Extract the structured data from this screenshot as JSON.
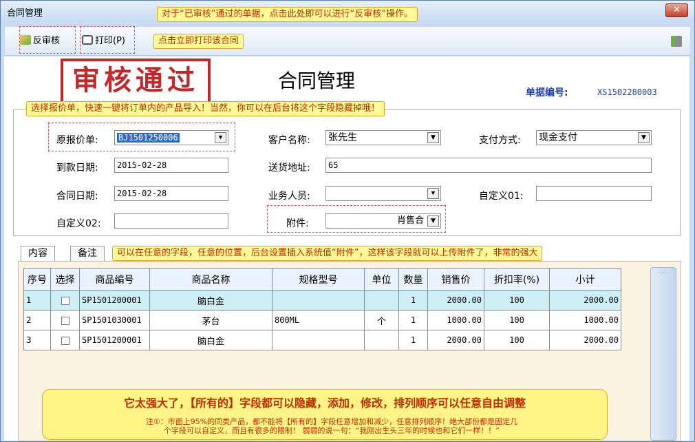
{
  "window": {
    "title": "合同管理",
    "close_glyph": "✕"
  },
  "toolbar": {
    "unreview_label": "反审核",
    "print_label": "打印(P)",
    "exit_icon": "exit-icon"
  },
  "callouts": {
    "unreview": "对于“已审核”通过的单据，点击此处即可以进行“反审核”操作。",
    "print": "点击立即打印该合同",
    "quote": "选择报价单，快速一键将订单内的产品导入！当然，你可以在后台将这个字段隐藏掉哦！",
    "attachment": "可以在任意的字段，任意的位置，后台设置插入系统值“附件”，这样该字段就可以上传附件了，非常的强大"
  },
  "header": {
    "stamp_text": "审核通过",
    "title": "合同管理",
    "doc_no_label": "单据编号:",
    "doc_no_value": "XS1502280003"
  },
  "form": {
    "quote_label": "原报价单:",
    "quote_value": "BJ1501250006",
    "customer_label": "客户名称:",
    "customer_value": "张先生",
    "payment_label": "支付方式:",
    "payment_value": "现金支付",
    "due_date_label": "到款日期:",
    "due_date_value": "2015-02-28",
    "address_label": "送货地址:",
    "address_value": "65",
    "contract_date_label": "合同日期:",
    "contract_date_value": "2015-02-28",
    "salesperson_label": "业务人员:",
    "salesperson_value": "",
    "custom01_label": "自定义01:",
    "custom01_value": "",
    "custom02_label": "自定义02:",
    "custom02_value": "",
    "attachment_label": "附件:",
    "attachment_value": "肖售合"
  },
  "tabs": [
    {
      "label": "内容"
    },
    {
      "label": "备注"
    }
  ],
  "grid": {
    "headers": [
      "序号",
      "选择",
      "商品编号",
      "商品名称",
      "规格型号",
      "单位",
      "数量",
      "销售价",
      "折扣率(%)",
      "小计"
    ],
    "rows": [
      {
        "no": "1",
        "code": "SP1501200001",
        "name": "脑白金",
        "spec": "",
        "unit": "",
        "qty": "1",
        "price": "2000.00",
        "discount": "100",
        "subtotal": "2000.00"
      },
      {
        "no": "2",
        "code": "SP1501030001",
        "name": "茅台",
        "spec": "800ML",
        "unit": "个",
        "qty": "1",
        "price": "1000.00",
        "discount": "100",
        "subtotal": "1000.00"
      },
      {
        "no": "3",
        "code": "SP1501200001",
        "name": "脑白金",
        "spec": "",
        "unit": "",
        "qty": "1",
        "price": "2000.00",
        "discount": "100",
        "subtotal": "2000.00"
      }
    ]
  },
  "note": {
    "main": "它太强大了，【所有的】字段都可以隐藏，添加，修改，排列顺序可以任意自由调整",
    "line1": "注①：市面上95%的同类产品，都不能将【所有的】字段任意增加和减少，任意排列顺序！绝大部份都是固定几",
    "line2": "个字段可以自定义，而且有很多的限制！   弱弱的说一句：“我刚出生头三年的时候也和它们一样！！”"
  },
  "scrollbar": {
    "grip": "····"
  },
  "colors": {
    "accent": "#1a3da8",
    "stamp": "#c0282a",
    "callout_bg": "#fffa95",
    "callout_text": "#c02a00"
  }
}
